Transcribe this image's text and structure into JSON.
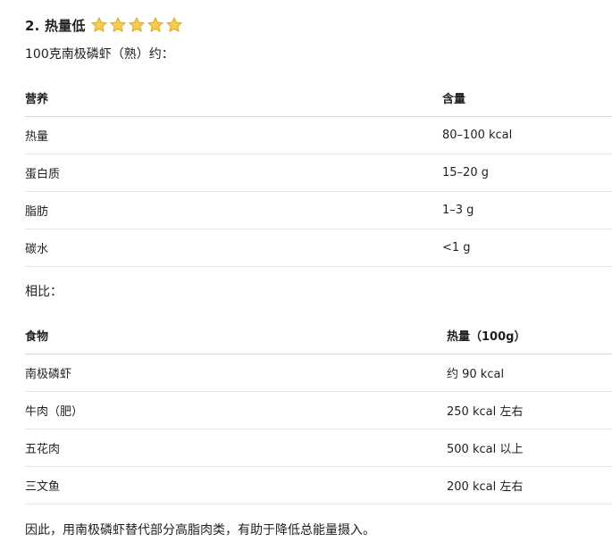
{
  "heading": {
    "title": "2. 热量低",
    "stars": [
      "star-icon",
      "star-icon",
      "star-icon",
      "star-icon",
      "star-icon"
    ],
    "star_color": "#F5C542"
  },
  "intro": "100克南极磷虾（熟）约：",
  "table1": {
    "headers": [
      "营养",
      "含量"
    ],
    "rows": [
      [
        "热量",
        "80–100 kcal"
      ],
      [
        "蛋白质",
        "15–20 g"
      ],
      [
        "脂肪",
        "1–3 g"
      ],
      [
        "碳水",
        "<1 g"
      ]
    ]
  },
  "compare_label": "相比：",
  "table2": {
    "headers": [
      "食物",
      "热量（100g）"
    ],
    "rows": [
      [
        "南极磷虾",
        "约 90 kcal"
      ],
      [
        "牛肉（肥）",
        "250 kcal 左右"
      ],
      [
        "五花肉",
        "500 kcal 以上"
      ],
      [
        "三文鱼",
        "200 kcal 左右"
      ]
    ]
  },
  "conclusion": "因此，用南极磷虾替代部分高脂肉类，有助于降低总能量摄入。"
}
